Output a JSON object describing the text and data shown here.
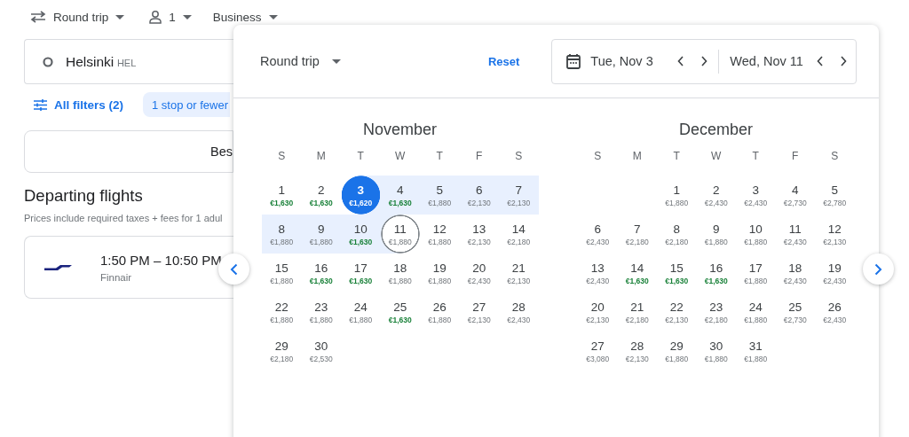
{
  "top_bar": {
    "trip_type": "Round trip",
    "passengers": "1",
    "cabin_class": "Business"
  },
  "origin": {
    "city": "Helsinki",
    "code": "HEL"
  },
  "filters": {
    "all_filters": "All filters (2)",
    "chips": [
      {
        "label": "1 stop or fewer",
        "selected": true
      }
    ]
  },
  "sort_tab": {
    "label": "Bes"
  },
  "departing": {
    "title": "Departing flights",
    "subtitle": "Prices include required taxes + fees for 1 adul",
    "flights": [
      {
        "times": "1:50 PM – 10:50 PM",
        "airline": "Finnair"
      }
    ]
  },
  "date_picker": {
    "trip_type": "Round trip",
    "reset": "Reset",
    "departure": "Tue, Nov 3",
    "return": "Wed, Nov 11",
    "months": [
      {
        "name": "November",
        "weekdays": [
          "S",
          "M",
          "T",
          "W",
          "T",
          "F",
          "S"
        ],
        "days": [
          {
            "kind": "day",
            "day": "1",
            "price": "€1,630",
            "low": true
          },
          {
            "kind": "day",
            "day": "2",
            "price": "€1,630",
            "low": true
          },
          {
            "kind": "start",
            "day": "3",
            "price": "€1,620"
          },
          {
            "kind": "range",
            "day": "4",
            "price": "€1,630",
            "low": true
          },
          {
            "kind": "range",
            "day": "5",
            "price": "€1,880",
            "low": false
          },
          {
            "kind": "range",
            "day": "6",
            "price": "€2,130",
            "low": false
          },
          {
            "kind": "range",
            "day": "7",
            "price": "€2,130",
            "low": false
          },
          {
            "kind": "range",
            "day": "8",
            "price": "€1,880",
            "low": false
          },
          {
            "kind": "range",
            "day": "9",
            "price": "€1,880",
            "low": false
          },
          {
            "kind": "range",
            "day": "10",
            "price": "€1,630",
            "low": true
          },
          {
            "kind": "end",
            "day": "11",
            "price": "€1,880",
            "low": false
          },
          {
            "kind": "day",
            "day": "12",
            "price": "€1,880",
            "low": false
          },
          {
            "kind": "day",
            "day": "13",
            "price": "€2,130",
            "low": false
          },
          {
            "kind": "day",
            "day": "14",
            "price": "€2,180",
            "low": false
          },
          {
            "kind": "day",
            "day": "15",
            "price": "€1,880",
            "low": false
          },
          {
            "kind": "day",
            "day": "16",
            "price": "€1,630",
            "low": true
          },
          {
            "kind": "day",
            "day": "17",
            "price": "€1,630",
            "low": true
          },
          {
            "kind": "day",
            "day": "18",
            "price": "€1,880",
            "low": false
          },
          {
            "kind": "day",
            "day": "19",
            "price": "€1,880",
            "low": false
          },
          {
            "kind": "day",
            "day": "20",
            "price": "€2,430",
            "low": false
          },
          {
            "kind": "day",
            "day": "21",
            "price": "€2,130",
            "low": false
          },
          {
            "kind": "day",
            "day": "22",
            "price": "€1,880",
            "low": false
          },
          {
            "kind": "day",
            "day": "23",
            "price": "€1,880",
            "low": false
          },
          {
            "kind": "day",
            "day": "24",
            "price": "€1,880",
            "low": false
          },
          {
            "kind": "day",
            "day": "25",
            "price": "€1,630",
            "low": true
          },
          {
            "kind": "day",
            "day": "26",
            "price": "€1,880",
            "low": false
          },
          {
            "kind": "day",
            "day": "27",
            "price": "€2,130",
            "low": false
          },
          {
            "kind": "day",
            "day": "28",
            "price": "€2,430",
            "low": false
          },
          {
            "kind": "day",
            "day": "29",
            "price": "€2,180",
            "low": false
          },
          {
            "kind": "day",
            "day": "30",
            "price": "€2,530",
            "low": false
          }
        ]
      },
      {
        "name": "December",
        "weekdays": [
          "S",
          "M",
          "T",
          "W",
          "T",
          "F",
          "S"
        ],
        "days": [
          {
            "kind": "blank"
          },
          {
            "kind": "blank"
          },
          {
            "kind": "day",
            "day": "1",
            "price": "€1,880",
            "low": false
          },
          {
            "kind": "day",
            "day": "2",
            "price": "€2,430",
            "low": false
          },
          {
            "kind": "day",
            "day": "3",
            "price": "€2,430",
            "low": false
          },
          {
            "kind": "day",
            "day": "4",
            "price": "€2,730",
            "low": false
          },
          {
            "kind": "day",
            "day": "5",
            "price": "€2,780",
            "low": false
          },
          {
            "kind": "day",
            "day": "6",
            "price": "€2,430",
            "low": false
          },
          {
            "kind": "day",
            "day": "7",
            "price": "€2,180",
            "low": false
          },
          {
            "kind": "day",
            "day": "8",
            "price": "€2,180",
            "low": false
          },
          {
            "kind": "day",
            "day": "9",
            "price": "€1,880",
            "low": false
          },
          {
            "kind": "day",
            "day": "10",
            "price": "€1,880",
            "low": false
          },
          {
            "kind": "day",
            "day": "11",
            "price": "€2,430",
            "low": false
          },
          {
            "kind": "day",
            "day": "12",
            "price": "€2,130",
            "low": false
          },
          {
            "kind": "day",
            "day": "13",
            "price": "€2,430",
            "low": false
          },
          {
            "kind": "day",
            "day": "14",
            "price": "€1,630",
            "low": true
          },
          {
            "kind": "day",
            "day": "15",
            "price": "€1,630",
            "low": true
          },
          {
            "kind": "day",
            "day": "16",
            "price": "€1,630",
            "low": true
          },
          {
            "kind": "day",
            "day": "17",
            "price": "€1,880",
            "low": false
          },
          {
            "kind": "day",
            "day": "18",
            "price": "€2,430",
            "low": false
          },
          {
            "kind": "day",
            "day": "19",
            "price": "€2,430",
            "low": false
          },
          {
            "kind": "day",
            "day": "20",
            "price": "€2,130",
            "low": false
          },
          {
            "kind": "day",
            "day": "21",
            "price": "€2,180",
            "low": false
          },
          {
            "kind": "day",
            "day": "22",
            "price": "€2,130",
            "low": false
          },
          {
            "kind": "day",
            "day": "23",
            "price": "€2,180",
            "low": false
          },
          {
            "kind": "day",
            "day": "24",
            "price": "€1,880",
            "low": false
          },
          {
            "kind": "day",
            "day": "25",
            "price": "€2,730",
            "low": false
          },
          {
            "kind": "day",
            "day": "26",
            "price": "€2,430",
            "low": false
          },
          {
            "kind": "day",
            "day": "27",
            "price": "€3,080",
            "low": false
          },
          {
            "kind": "day",
            "day": "28",
            "price": "€2,130",
            "low": false
          },
          {
            "kind": "day",
            "day": "29",
            "price": "€1,880",
            "low": false
          },
          {
            "kind": "day",
            "day": "30",
            "price": "€1,880",
            "low": false
          },
          {
            "kind": "day",
            "day": "31",
            "price": "€1,880",
            "low": false
          }
        ]
      }
    ]
  }
}
